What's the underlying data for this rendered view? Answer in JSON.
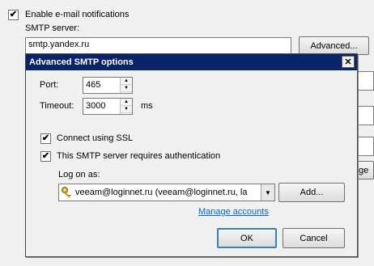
{
  "background": {
    "enable_notifications": {
      "label": "Enable e-mail notifications",
      "checked": true
    },
    "smtp_server_label": "SMTP server:",
    "smtp_server_value": "smtp.yandex.ru",
    "advanced_button": "Advanced...",
    "partial_button": "ge"
  },
  "dialog": {
    "title": "Advanced SMTP options",
    "close_glyph": "✕",
    "port_label": "Port:",
    "port_value": "465",
    "timeout_label": "Timeout:",
    "timeout_value": "3000",
    "timeout_unit": "ms",
    "ssl": {
      "label": "Connect using SSL",
      "checked": true
    },
    "auth": {
      "label": "This SMTP server requires authentication",
      "checked": true
    },
    "logon_label": "Log on as:",
    "account_value": "veeam@loginnet.ru (veeam@loginnet.ru, la",
    "add_button": "Add...",
    "manage_link": "Manage accounts",
    "ok_button": "OK",
    "cancel_button": "Cancel"
  },
  "colors": {
    "titlebar": "#0a246a",
    "link": "#0066cc"
  },
  "icons": {
    "account": "key-icon",
    "dropdown": "chevron-down-icon",
    "spin_up": "spin-up-icon",
    "spin_down": "spin-down-icon"
  }
}
